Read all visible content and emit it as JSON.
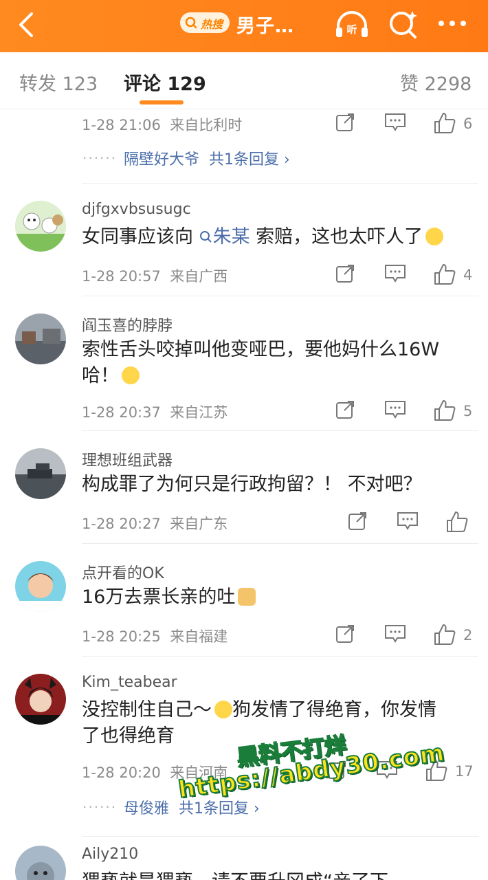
{
  "header": {
    "hot_badge": "热搜",
    "title": "男子…"
  },
  "tabs": {
    "repost": "转发 123",
    "comments": "评论 129",
    "likes": "赞 2298"
  },
  "comments": [
    {
      "time": "1-28 21:06",
      "location": "来自比利时",
      "likes": "6",
      "reply_user": "隔壁好大爷",
      "reply_count": "共1条回复 ›"
    },
    {
      "username": "djfgxvbsusugc",
      "text_before": "女同事应该向",
      "mention": "朱某",
      "text_after": " 索赔，这也太吓人了",
      "time": "1-28 20:57",
      "location": "来自广西",
      "likes": "4"
    },
    {
      "username": "阎玉喜的脖脖",
      "text": "索性舌头咬掉叫他变哑巴，要他妈什么16W哈！",
      "time": "1-28 20:37",
      "location": "来自江苏",
      "likes": "5"
    },
    {
      "username": "理想班组武器",
      "text": "构成罪了为何只是行政拘留？！ 不对吧？",
      "time": "1-28 20:27",
      "location": "来自广东",
      "likes": ""
    },
    {
      "username": "点开看的OK",
      "text": "16万去票长亲的吐",
      "time": "1-28 20:25",
      "location": "来自福建",
      "likes": "2"
    },
    {
      "username": "Kim_teabear",
      "text_line1": "没控制住自己～",
      "text_line1b": "狗发情了得绝育，你发情",
      "text_line2": "了也得绝育",
      "time": "1-28 20:20",
      "location": "来自河南",
      "likes": "17",
      "reply_user": "母俊雅",
      "reply_count": "共1条回复 ›"
    },
    {
      "username": "Aily210",
      "text": "猥亵就是猥亵，请不要升冈成“亲了下"
    }
  ],
  "watermark": {
    "line1": "黑料不打烊",
    "line2": "https://abdy30.com"
  },
  "colors": {
    "brand_orange": "#ff8a1f",
    "link_blue": "#4b6eaa"
  }
}
